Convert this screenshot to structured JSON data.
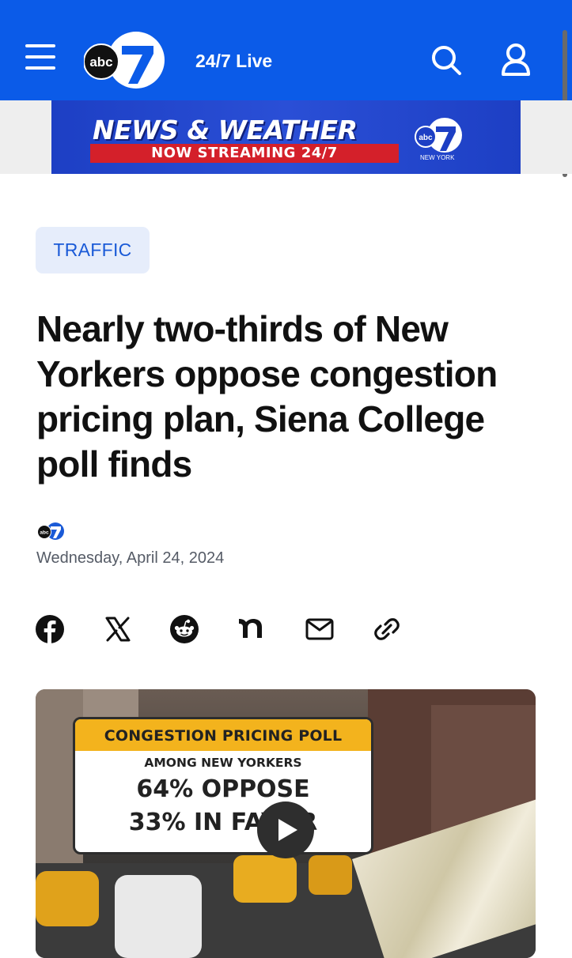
{
  "header": {
    "live_label": "24/7 Live",
    "logo_text": "abc",
    "logo_number": "7",
    "accent_color": "#0b5be8"
  },
  "banner": {
    "title": "NEWS & WEATHER",
    "subtitle": "NOW STREAMING 24/7",
    "logo_text": "abc",
    "logo_number": "7",
    "logo_caption": "NEW YORK"
  },
  "article": {
    "category": "TRAFFIC",
    "headline": "Nearly two-thirds of New Yorkers oppose congestion pricing plan, Siena College poll finds",
    "date": "Wednesday, April 24, 2024",
    "byline_logo_text": "abc",
    "byline_logo_number": "7"
  },
  "share_icons": [
    "facebook-icon",
    "x-icon",
    "reddit-icon",
    "nextdoor-icon",
    "email-icon",
    "link-icon"
  ],
  "video": {
    "card_title": "CONGESTION PRICING POLL",
    "card_subtitle": "AMONG NEW YORKERS",
    "line_1": "64% OPPOSE",
    "line_2": "33% IN FAVOR"
  }
}
